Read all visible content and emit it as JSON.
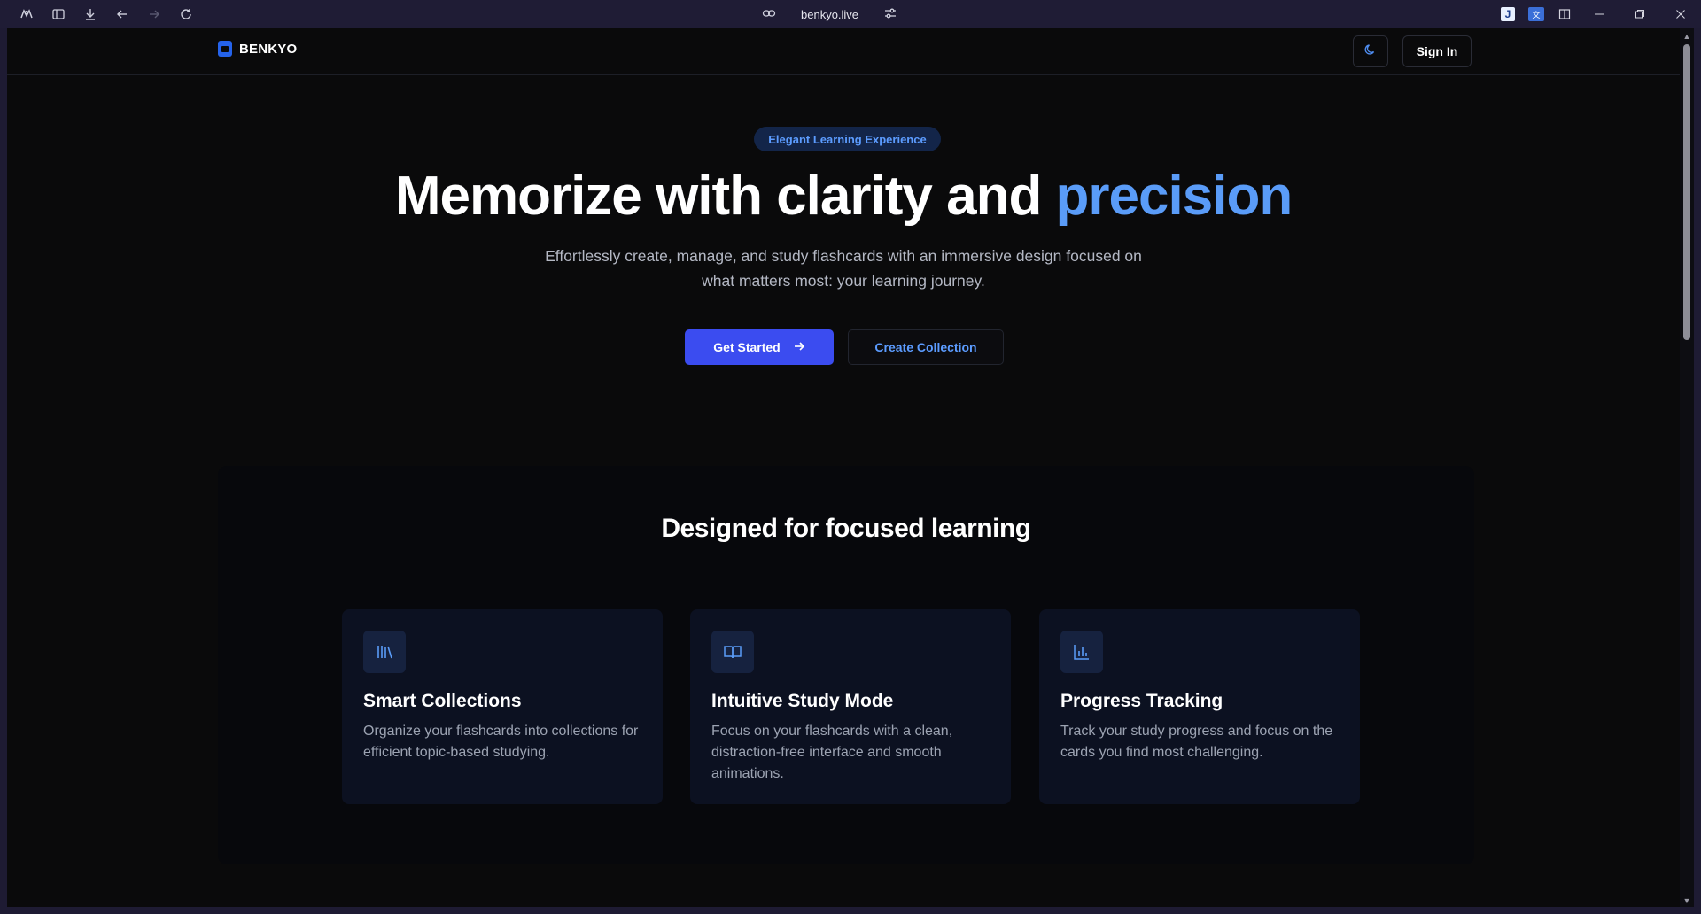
{
  "browser": {
    "url": "benkyo.live",
    "toolbar_icons": [
      "workspaces-icon",
      "sidebar-icon",
      "download-icon",
      "back-icon",
      "forward-icon",
      "reload-icon"
    ],
    "extensions": [
      "J",
      "文"
    ]
  },
  "nav": {
    "brand": "BENKYO",
    "signin_label": "Sign In"
  },
  "hero": {
    "pill": "Elegant Learning Experience",
    "headline_main": "Memorize with clarity and ",
    "headline_accent": "precision",
    "subtext": "Effortlessly create, manage, and study flashcards with an immersive design focused on what matters most: your learning journey.",
    "primary_button": "Get Started",
    "secondary_button": "Create Collection"
  },
  "features": {
    "title": "Designed for focused learning",
    "cards": [
      {
        "icon": "library-icon",
        "title": "Smart Collections",
        "text": "Organize your flashcards into collections for efficient topic-based studying."
      },
      {
        "icon": "book-open-icon",
        "title": "Intuitive Study Mode",
        "text": "Focus on your flashcards with a clean, distraction-free interface and smooth animations."
      },
      {
        "icon": "bar-chart-icon",
        "title": "Progress Tracking",
        "text": "Track your study progress and focus on the cards you find most challenging."
      }
    ]
  },
  "colors": {
    "background": "#0a0a0b",
    "accent": "#5a9cf8",
    "primary_button": "#3b4cf0",
    "card": "#0c1121"
  }
}
